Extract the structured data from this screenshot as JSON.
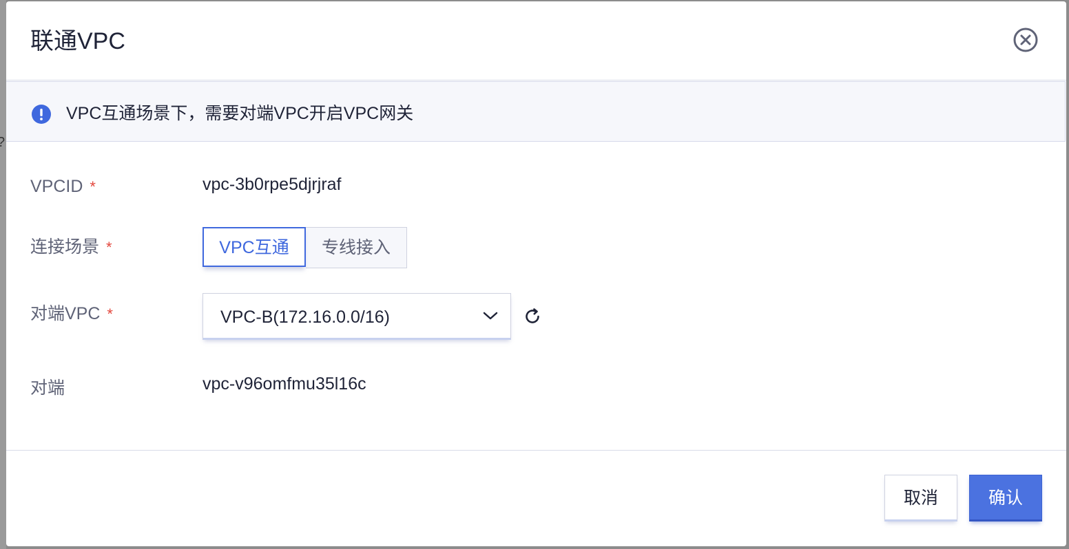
{
  "dialog": {
    "title": "联通VPC"
  },
  "notice": {
    "text": "VPC互通场景下，需要对端VPC开启VPC网关"
  },
  "form": {
    "vpcid": {
      "label": "VPCID",
      "required_mark": "*",
      "value": "vpc-3b0rpe5djrjraf"
    },
    "scene": {
      "label": "连接场景",
      "required_mark": "*",
      "options": [
        "VPC互通",
        "专线接入"
      ],
      "selected": "VPC互通"
    },
    "peer_vpc": {
      "label": "对端VPC",
      "required_mark": "*",
      "selected_value": "VPC-B(172.16.0.0/16)"
    },
    "peer": {
      "label": "对端",
      "value": "vpc-v96omfmu35l16c"
    }
  },
  "footer": {
    "cancel_label": "取消",
    "confirm_label": "确认"
  },
  "backdrop": {
    "partial_glyph": "?"
  },
  "colors": {
    "accent": "#4b72e0",
    "required": "#e3473d",
    "notice_icon": "#3f68de"
  },
  "icons": {
    "close": "close-circle-icon",
    "info": "info-circle-icon",
    "chevron": "chevron-down-icon",
    "refresh": "refresh-icon"
  }
}
